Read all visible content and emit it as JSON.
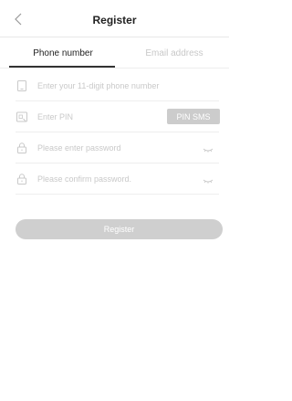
{
  "header": {
    "title": "Register",
    "back_icon": "chevron-left-icon"
  },
  "tabs": [
    {
      "label": "Phone number",
      "active": true
    },
    {
      "label": "Email address",
      "active": false
    }
  ],
  "form": {
    "phone": {
      "placeholder": "Enter your 11-digit phone number",
      "value": "",
      "icon": "phone-icon"
    },
    "pin": {
      "placeholder": "Enter PIN",
      "value": "",
      "icon": "sms-code-icon",
      "button_label": "PIN SMS"
    },
    "password": {
      "placeholder": "Please enter password",
      "value": "",
      "icon": "lock-icon",
      "toggle_icon": "eye-closed-icon"
    },
    "confirm_password": {
      "placeholder": "Please confirm password.",
      "value": "",
      "icon": "lock-icon",
      "toggle_icon": "eye-closed-icon"
    },
    "submit_label": "Register"
  },
  "colors": {
    "accent_disabled": "#cccccc",
    "placeholder": "#c9c9c9",
    "active_tab": "#222222",
    "inactive_tab": "#c8c8c8"
  }
}
